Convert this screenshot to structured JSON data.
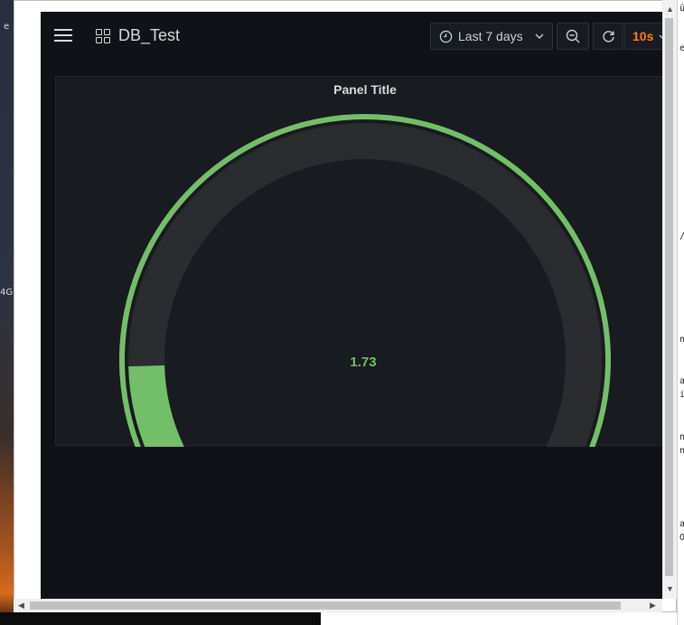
{
  "dashboard": {
    "title": "DB_Test"
  },
  "toolbar": {
    "time_range": "Last 7 days",
    "refresh_interval": "10s"
  },
  "panel": {
    "title": "Panel Title",
    "gauge": {
      "value_text": "1.73",
      "value": 1.73,
      "min": 0,
      "max": 10,
      "color": "#73bf69",
      "track_color": "#2a2c30"
    }
  },
  "background": {
    "desktop_fragments": [
      "e",
      "4G"
    ],
    "editor_fragments": [
      "ü",
      "er",
      "/",
      "n",
      "a",
      "i",
      "n",
      "n",
      "a",
      "O"
    ]
  },
  "colors": {
    "accent": "#ff7b18",
    "gauge": "#73bf69",
    "panel_bg": "#181b1f",
    "page_bg": "#111217"
  }
}
